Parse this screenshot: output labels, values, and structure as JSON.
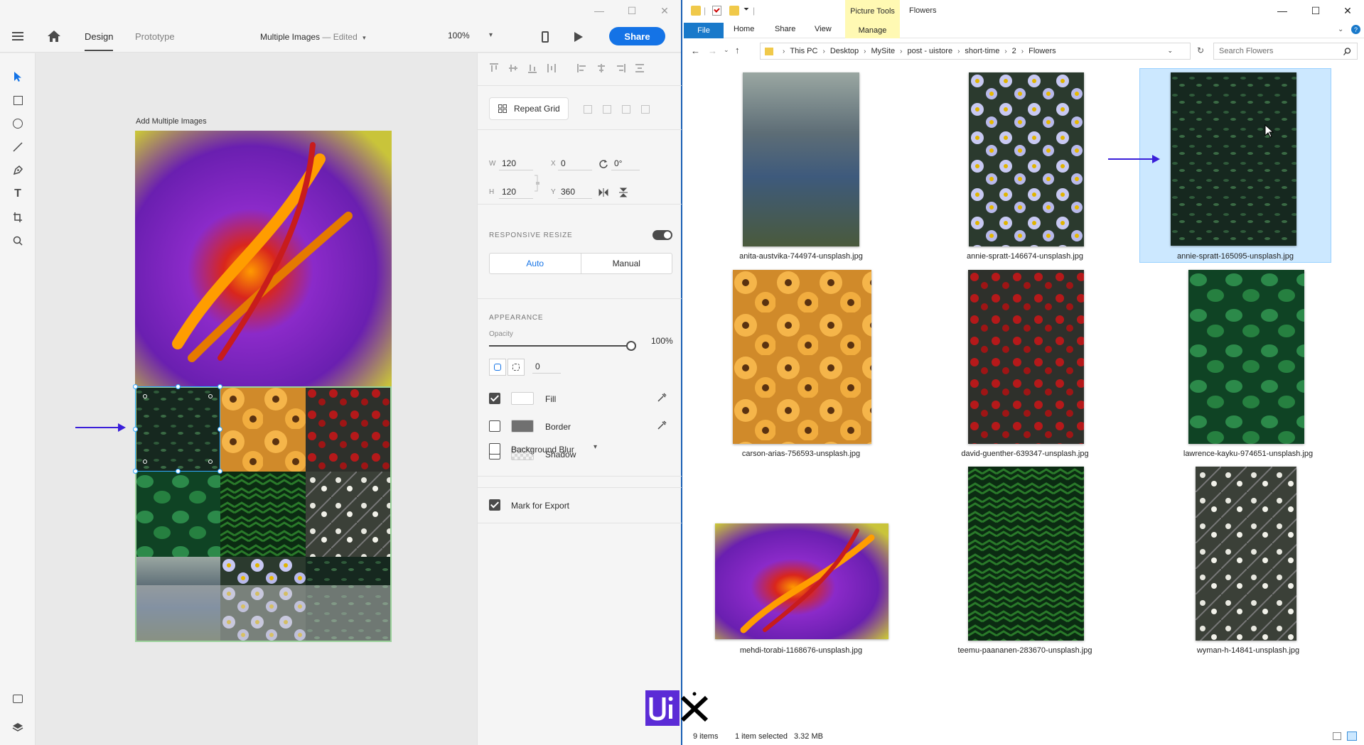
{
  "xd": {
    "tabs": {
      "design": "Design",
      "prototype": "Prototype"
    },
    "document": {
      "title": "Multiple Images",
      "separator": " — ",
      "status": "Edited"
    },
    "zoom": "100%",
    "share_label": "Share",
    "artboard_label": "Add Multiple Images",
    "properties": {
      "repeat_grid_label": "Repeat Grid",
      "w_label": "W",
      "w_value": "120",
      "h_label": "H",
      "h_value": "120",
      "x_label": "X",
      "x_value": "0",
      "y_label": "Y",
      "y_value": "360",
      "rotation_value": "0°",
      "responsive_resize_title": "RESPONSIVE RESIZE",
      "responsive_resize_on": true,
      "resize_auto": "Auto",
      "resize_manual": "Manual",
      "appearance_title": "APPEARANCE",
      "opacity_label": "Opacity",
      "opacity_value": "100%",
      "opacity_fraction": 1.0,
      "corner_radius_value": "0",
      "fill_label": "Fill",
      "fill_checked": true,
      "fill_color": "#ffffff",
      "border_label": "Border",
      "border_checked": false,
      "border_color": "#707070",
      "shadow_label": "Shadow",
      "shadow_checked": false,
      "background_blur_label": "Background Blur",
      "background_blur_checked": false,
      "mark_for_export_label": "Mark for Export",
      "mark_for_export_checked": true
    },
    "accent_color": "#1473e6"
  },
  "explorer": {
    "ribbon_context": "Picture Tools",
    "window_title": "Flowers",
    "tabs": {
      "file": "File",
      "home": "Home",
      "share": "Share",
      "view": "View",
      "manage": "Manage"
    },
    "breadcrumb": [
      "This PC",
      "Desktop",
      "MySite",
      "post - uistore",
      "short-time",
      "2",
      "Flowers"
    ],
    "search_placeholder": "Search Flowers",
    "files": [
      {
        "name": "anita-austvika-744974-unsplash.jpg"
      },
      {
        "name": "annie-spratt-146674-unsplash.jpg"
      },
      {
        "name": "annie-spratt-165095-unsplash.jpg"
      },
      {
        "name": "carson-arias-756593-unsplash.jpg"
      },
      {
        "name": "david-guenther-639347-unsplash.jpg"
      },
      {
        "name": "lawrence-kayku-974651-unsplash.jpg"
      },
      {
        "name": "mehdi-torabi-1168676-unsplash.jpg"
      },
      {
        "name": "teemu-paananen-283670-unsplash.jpg"
      },
      {
        "name": "wyman-h-14841-unsplash.jpg"
      }
    ],
    "status": {
      "items": "9 items",
      "selected": "1 item selected",
      "size": "3.32 MB"
    },
    "selection_color": "#cce8ff"
  }
}
